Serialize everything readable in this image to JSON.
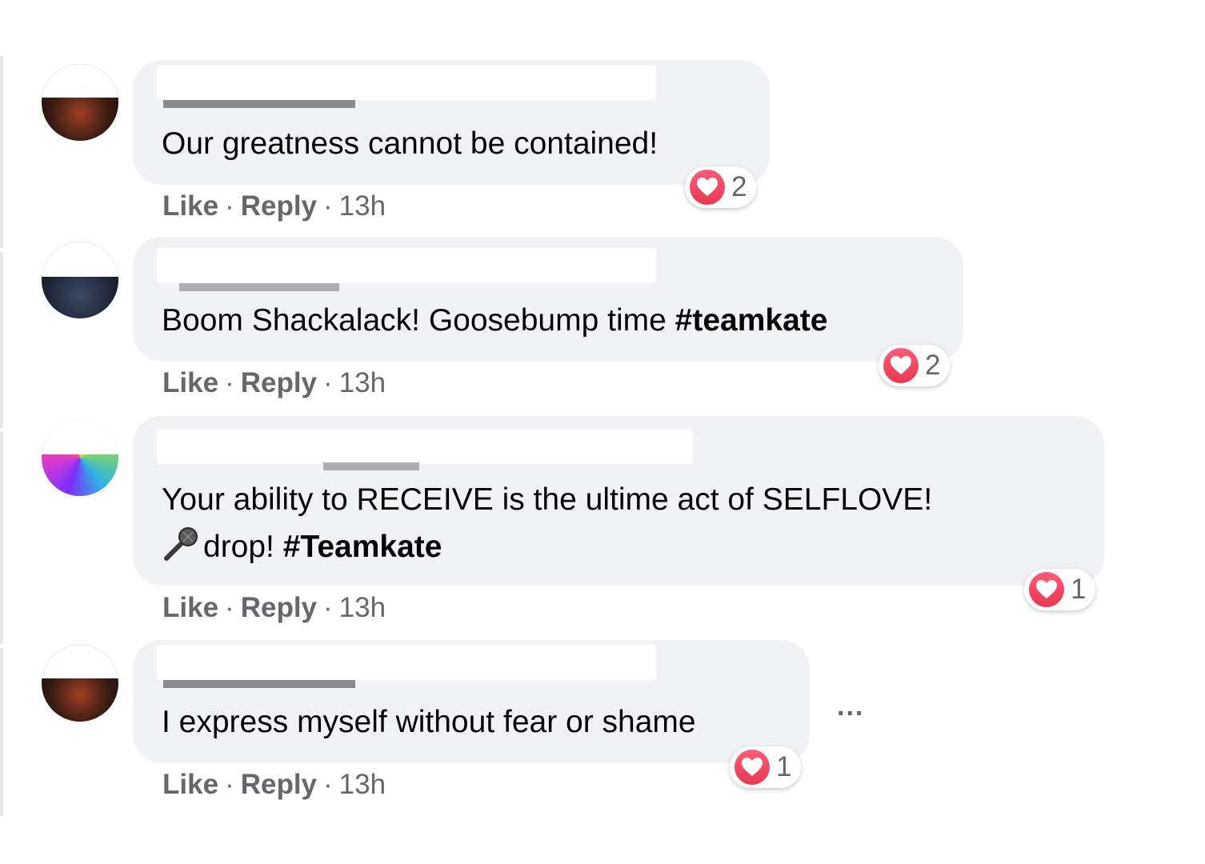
{
  "comments": [
    {
      "text": "Our greatness cannot be contained!",
      "like_label": "Like",
      "reply_label": "Reply",
      "time": "13h",
      "reactions": "2"
    },
    {
      "text": "Boom Shackalack! Goosebump time ",
      "hashtag": "#teamkate",
      "like_label": "Like",
      "reply_label": "Reply",
      "time": "13h",
      "reactions": "2"
    },
    {
      "text_line1": "Your ability to RECEIVE is the ultime act of SELFLOVE!",
      "text_line2": "drop! ",
      "emoji": "microphone-icon",
      "hashtag": "#Teamkate",
      "like_label": "Like",
      "reply_label": "Reply",
      "time": "13h",
      "reactions": "1"
    },
    {
      "text": "I express myself without fear or shame",
      "like_label": "Like",
      "reply_label": "Reply",
      "time": "13h",
      "reactions": "1"
    }
  ],
  "separator": "·",
  "more_options_label": "...",
  "colors": {
    "bubble": "#f0f2f5",
    "meta_text": "#65676b",
    "heart": "#f33e58"
  }
}
